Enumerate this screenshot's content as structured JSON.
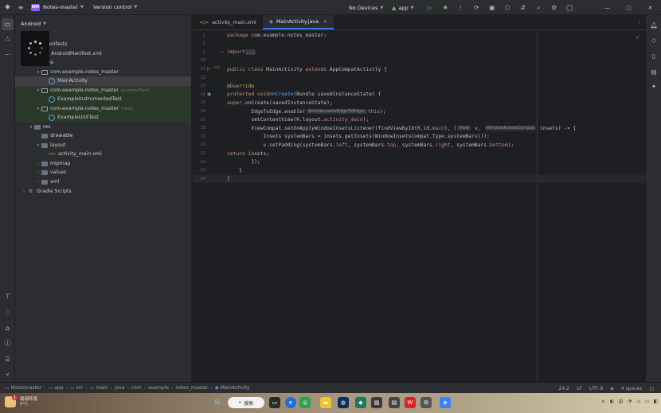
{
  "titlebar": {
    "project_badge": "NM",
    "project_name": "Notes-master",
    "version_control": "Version control",
    "devices": "No Devices",
    "run_config": "app"
  },
  "project_panel": {
    "view_mode": "Android",
    "tree": [
      {
        "label": "manifests",
        "indent": 1,
        "arrow": "▾",
        "icon": "folder",
        "suffix": "",
        "state": ""
      },
      {
        "label": "AndroidManifest.xml",
        "indent": 2,
        "arrow": "",
        "icon": "mani",
        "suffix": "",
        "state": ""
      },
      {
        "label": "java",
        "indent": 1,
        "arrow": "▾",
        "icon": "folder",
        "suffix": "",
        "state": ""
      },
      {
        "label": "com.example.notes_master",
        "indent": 2,
        "arrow": "▾",
        "icon": "pkg",
        "suffix": "",
        "state": ""
      },
      {
        "label": "MainActivity",
        "indent": 3,
        "arrow": "",
        "icon": "cls",
        "suffix": "",
        "state": "sel"
      },
      {
        "label": "com.example.notes_master",
        "indent": 2,
        "arrow": "▾",
        "icon": "pkg",
        "suffix": "(androidTest)",
        "state": "test"
      },
      {
        "label": "ExampleInstrumentedTest",
        "indent": 3,
        "arrow": "",
        "icon": "cls",
        "suffix": "",
        "state": "test"
      },
      {
        "label": "com.example.notes_master",
        "indent": 2,
        "arrow": "▾",
        "icon": "pkg",
        "suffix": "(test)",
        "state": "test"
      },
      {
        "label": "ExampleUnitTest",
        "indent": 3,
        "arrow": "",
        "icon": "cls",
        "suffix": "",
        "state": "test"
      },
      {
        "label": "res",
        "indent": 1,
        "arrow": "▾",
        "icon": "folder",
        "suffix": "",
        "state": ""
      },
      {
        "label": "drawable",
        "indent": 2,
        "arrow": "›",
        "icon": "folder",
        "suffix": "",
        "state": ""
      },
      {
        "label": "layout",
        "indent": 2,
        "arrow": "▾",
        "icon": "folder",
        "suffix": "",
        "state": ""
      },
      {
        "label": "activity_main.xml",
        "indent": 3,
        "arrow": "",
        "icon": "xml",
        "suffix": "",
        "state": ""
      },
      {
        "label": "mipmap",
        "indent": 2,
        "arrow": "›",
        "icon": "folder",
        "suffix": "",
        "state": ""
      },
      {
        "label": "values",
        "indent": 2,
        "arrow": "›",
        "icon": "folder",
        "suffix": "",
        "state": ""
      },
      {
        "label": "xml",
        "indent": 2,
        "arrow": "›",
        "icon": "folder",
        "suffix": "",
        "state": ""
      },
      {
        "label": "Gradle Scripts",
        "indent": 0,
        "arrow": "›",
        "icon": "gradle",
        "suffix": "",
        "state": ""
      }
    ]
  },
  "editor": {
    "tabs": [
      {
        "label": "activity_main.xml",
        "icon": "</>",
        "active": false
      },
      {
        "label": "MainActivity.java",
        "icon": "◉",
        "active": true
      }
    ],
    "current_line": 24,
    "lines": [
      {
        "n": "1",
        "html": "<span class='kw'>package</span> com.example.notes_master;"
      },
      {
        "n": "2",
        "html": ""
      },
      {
        "n": "3",
        "html": "<span class='kw'>import</span> <span class='fold'>...</span>"
      },
      {
        "n": "10",
        "html": ""
      },
      {
        "n": "11",
        "html": "<span class='kw'>public class</span> MainActivity <span class='kw'>extends</span> AppCompatActivity {"
      },
      {
        "n": "12",
        "html": ""
      },
      {
        "n": "13",
        "html": "    <span class='an'>@Override</span>"
      },
      {
        "n": "14",
        "html": "    <span class='kw'>protected void</span> <span class='fn'>onCreate</span>(Bundle savedInstanceState) {"
      },
      {
        "n": "15",
        "html": "        <span class='kw'>super</span>.onCreate(savedInstanceState);"
      },
      {
        "n": "16",
        "html": "        EdgeToEdge.<span class='it'>enable</span>(<span class='hint'>$this$enableEdgeToEdge:</span> <span class='kw'>this</span>);"
      },
      {
        "n": "17",
        "html": "        setContentView(R.layout.<span class='fld it'>activity_main</span>);"
      },
      {
        "n": "18",
        "html": "        ViewCompat.<span class='it'>setOnApplyWindowInsetsListener</span>(findViewById(R.id.<span class='fld it'>main</span>), (<span class='hint'>View</span> v, <span class='hint'>WindowInsetsCompat</span> insets) -&gt; {"
      },
      {
        "n": "19",
        "html": "            Insets systemBars = insets.getInsets(WindowInsetsCompat.Type.<span class='it'>systemBars</span>());"
      },
      {
        "n": "20",
        "html": "            v.setPadding(systemBars.<span class='fld'>left</span>, systemBars.<span class='fld'>top</span>, systemBars.<span class='fld'>right</span>, systemBars.<span class='fld'>bottom</span>);"
      },
      {
        "n": "21",
        "html": "            <span class='kw'>return</span> insets;"
      },
      {
        "n": "22",
        "html": "        });"
      },
      {
        "n": "23",
        "html": "    }"
      },
      {
        "n": "24",
        "html": "}"
      }
    ]
  },
  "statusbar": {
    "breadcrumbs": [
      "Notesmaster",
      "app",
      "src",
      "main",
      "java",
      "com",
      "example",
      "notes_master",
      "MainActivity"
    ],
    "position": "24:2",
    "line_sep": "LF",
    "encoding": "UTF-8",
    "indent": "4 spaces"
  },
  "taskbar": {
    "weather_line1": "局部阵雨",
    "weather_line2": "0°C",
    "search_label": "搜索"
  },
  "colors": {
    "accent": "#3574f0",
    "run": "#5fb85b",
    "keyword": "#cf8e6d",
    "function": "#56a8f5"
  }
}
